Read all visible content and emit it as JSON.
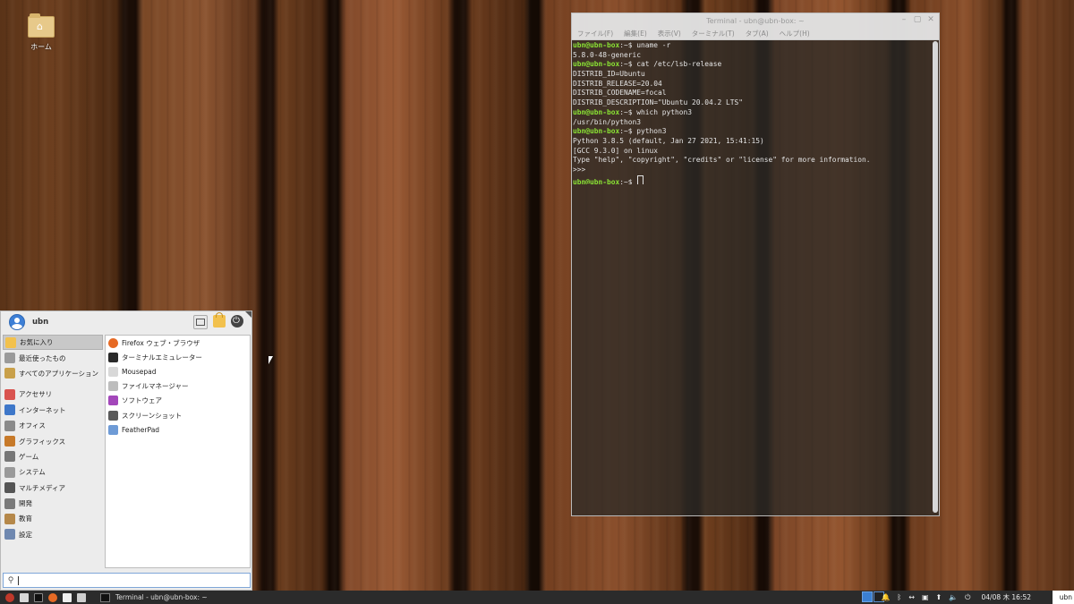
{
  "desktop": {
    "home_icon_label": "ホーム"
  },
  "terminal": {
    "title": "Terminal - ubn@ubn-box: ~",
    "menus": [
      "ファイル(F)",
      "編集(E)",
      "表示(V)",
      "ターミナル(T)",
      "タブ(A)",
      "ヘルプ(H)"
    ],
    "lines": [
      {
        "prompt": "ubn@ubn-box",
        "path": ":~$",
        "text": " uname -r"
      },
      {
        "prompt": "",
        "path": "",
        "text": "5.8.0-48-generic"
      },
      {
        "prompt": "ubn@ubn-box",
        "path": ":~$",
        "text": " cat /etc/lsb-release"
      },
      {
        "prompt": "",
        "path": "",
        "text": "DISTRIB_ID=Ubuntu"
      },
      {
        "prompt": "",
        "path": "",
        "text": "DISTRIB_RELEASE=20.04"
      },
      {
        "prompt": "",
        "path": "",
        "text": "DISTRIB_CODENAME=focal"
      },
      {
        "prompt": "",
        "path": "",
        "text": "DISTRIB_DESCRIPTION=\"Ubuntu 20.04.2 LTS\""
      },
      {
        "prompt": "ubn@ubn-box",
        "path": ":~$",
        "text": " which python3"
      },
      {
        "prompt": "",
        "path": "",
        "text": "/usr/bin/python3"
      },
      {
        "prompt": "ubn@ubn-box",
        "path": ":~$",
        "text": " python3"
      },
      {
        "prompt": "",
        "path": "",
        "text": "Python 3.8.5 (default, Jan 27 2021, 15:41:15)"
      },
      {
        "prompt": "",
        "path": "",
        "text": "[GCC 9.3.0] on linux"
      },
      {
        "prompt": "",
        "path": "",
        "text": "Type \"help\", \"copyright\", \"credits\" or \"license\" for more information."
      },
      {
        "prompt": "",
        "path": "",
        "text": ">>>"
      },
      {
        "prompt": "ubn@ubn-box",
        "path": ":~$",
        "text": " "
      }
    ]
  },
  "whisker": {
    "username": "ubn",
    "categories": [
      {
        "label": "お気に入り",
        "icon": "star-icon",
        "color": "#f2c14d",
        "selected": true
      },
      {
        "label": "最近使ったもの",
        "icon": "clock-icon",
        "color": "#9a9a9a"
      },
      {
        "label": "すべてのアプリケーション",
        "icon": "apps-icon",
        "color": "#c9a04a"
      },
      {
        "label": "アクセサリ",
        "icon": "accessories-icon",
        "color": "#d9534f"
      },
      {
        "label": "インターネット",
        "icon": "globe-icon",
        "color": "#3e77c9"
      },
      {
        "label": "オフィス",
        "icon": "office-icon",
        "color": "#8a8a8a"
      },
      {
        "label": "グラフィックス",
        "icon": "graphics-icon",
        "color": "#c77a2a"
      },
      {
        "label": "ゲーム",
        "icon": "game-icon",
        "color": "#777777"
      },
      {
        "label": "システム",
        "icon": "system-icon",
        "color": "#9a9a9a"
      },
      {
        "label": "マルチメディア",
        "icon": "multimedia-icon",
        "color": "#555555"
      },
      {
        "label": "開発",
        "icon": "development-icon",
        "color": "#7a7a7a"
      },
      {
        "label": "教育",
        "icon": "education-icon",
        "color": "#b5884a"
      },
      {
        "label": "設定",
        "icon": "settings-icon",
        "color": "#6f88b0"
      }
    ],
    "apps": [
      {
        "label": "Firefox ウェブ・ブラウザ",
        "icon": "firefox-icon",
        "color": "#e66a25"
      },
      {
        "label": "ターミナルエミュレーター",
        "icon": "terminal-icon",
        "color": "#2a2a2a"
      },
      {
        "label": "Mousepad",
        "icon": "mousepad-icon",
        "color": "#d8d8d8"
      },
      {
        "label": "ファイルマネージャー",
        "icon": "file-manager-icon",
        "color": "#bdbdbd"
      },
      {
        "label": "ソフトウェア",
        "icon": "software-icon",
        "color": "#a347ba"
      },
      {
        "label": "スクリーンショット",
        "icon": "screenshot-icon",
        "color": "#5a5a5a"
      },
      {
        "label": "FeatherPad",
        "icon": "featherpad-icon",
        "color": "#6e9bd6"
      }
    ],
    "search_placeholder": ""
  },
  "panel": {
    "task_label": "Terminal - ubn@ubn-box: ~",
    "clock": "04/08 木 16:52",
    "user": "ubn"
  }
}
